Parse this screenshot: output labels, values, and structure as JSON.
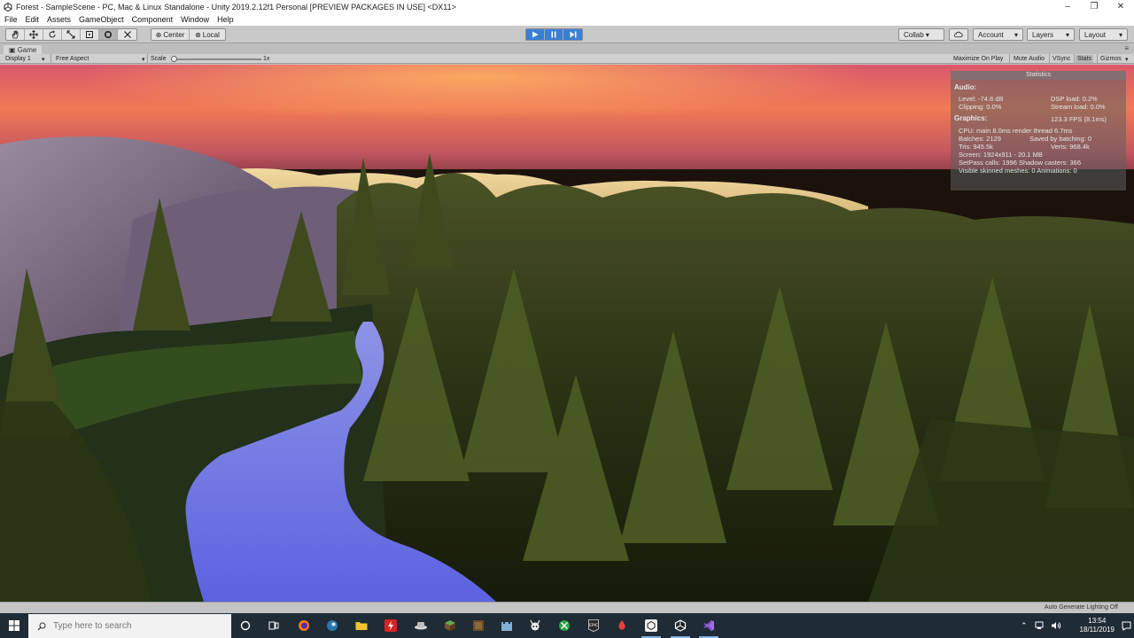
{
  "window": {
    "title": "Forest - SampleScene - PC, Mac & Linux Standalone - Unity 2019.2.12f1 Personal [PREVIEW PACKAGES IN USE] <DX11>",
    "minimize": "–",
    "maximize": "❐",
    "close": "✕"
  },
  "menu": [
    "File",
    "Edit",
    "Assets",
    "GameObject",
    "Component",
    "Window",
    "Help"
  ],
  "toolbar": {
    "pivot": "Center",
    "space": "Local",
    "collab": "Collab ▾",
    "account": "Account",
    "layers": "Layers",
    "layout": "Layout",
    "play_state": "playing"
  },
  "game_tab": {
    "tab_label": "Game",
    "display": "Display 1",
    "aspect": "Free Aspect",
    "scale_label": "Scale",
    "scale_value": "1x",
    "buttons": [
      "Maximize On Play",
      "Mute Audio",
      "VSync",
      "Stats",
      "Gizmos"
    ]
  },
  "stats": {
    "header": "Statistics",
    "audio_label": "Audio:",
    "level": "Level: -74.8 dB",
    "clipping": "Clipping: 0.0%",
    "dsp": "DSP load: 0.2%",
    "stream": "Stream load: 0.0%",
    "graphics_label": "Graphics:",
    "fps": "123.3 FPS (8.1ms)",
    "cpu": "CPU: main 8.0ms  render thread 6.7ms",
    "batches": "Batches: 2129",
    "saved": "Saved by batching: 0",
    "tris": "Tris: 945.5k",
    "verts": "Verts: 968.4k",
    "screen": "Screen: 1924x911 - 20.1 MB",
    "setpass": "SetPass calls: 1996  Shadow casters: 366",
    "skinned": "Visible skinned meshes: 0  Animations: 0"
  },
  "status_bar": {
    "right_text": "Auto Generate Lighting Off"
  },
  "taskbar": {
    "search_placeholder": "Type here to search",
    "time": "13:54",
    "date": "18/11/2019"
  },
  "colors": {
    "play_active": "#3a7fd6",
    "taskbar": "#1f2b35",
    "editor_gray": "#c8c8c8"
  }
}
